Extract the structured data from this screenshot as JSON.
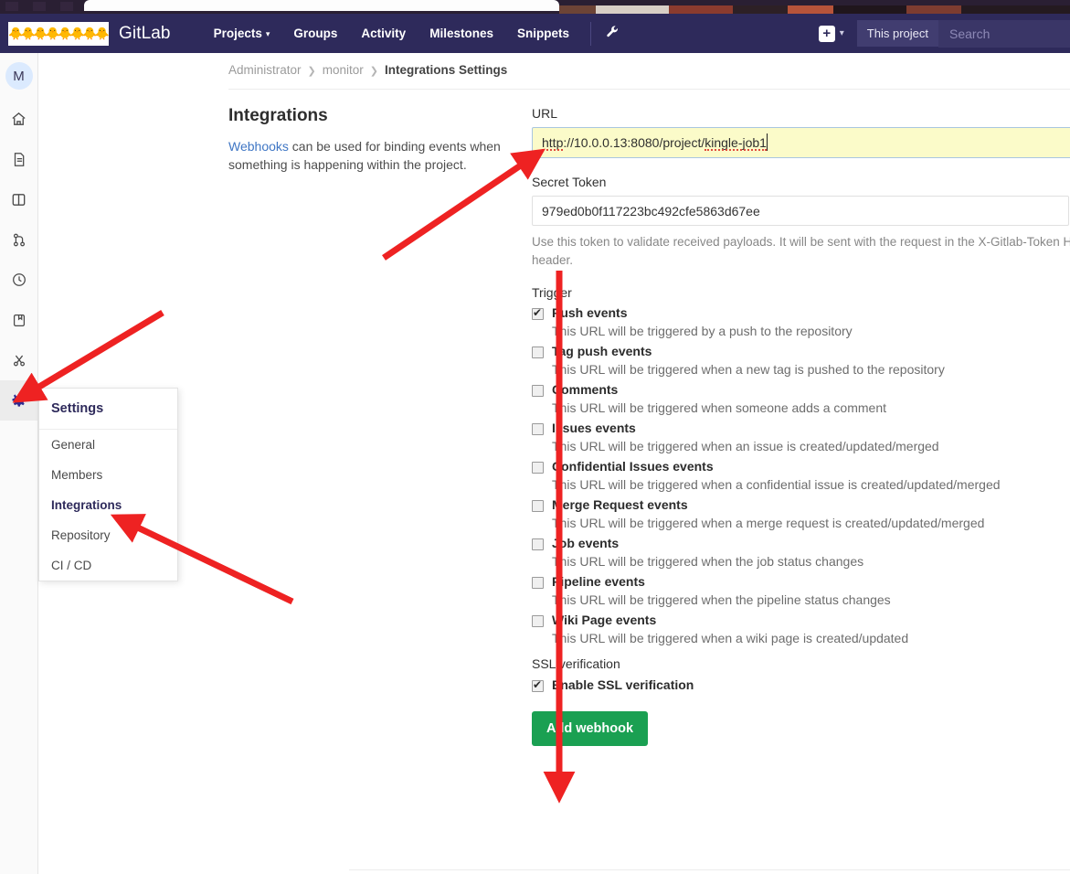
{
  "topnav": {
    "brand": "GitLab",
    "logo_emoji": "🐥",
    "logo_emoji_count": 8,
    "links": [
      {
        "label": "Projects",
        "has_caret": true
      },
      {
        "label": "Groups",
        "has_caret": false
      },
      {
        "label": "Activity",
        "has_caret": false
      },
      {
        "label": "Milestones",
        "has_caret": false
      },
      {
        "label": "Snippets",
        "has_caret": false
      }
    ],
    "wrench_icon": "wrench-icon",
    "plus_label": "+",
    "scope_label": "This project",
    "search_placeholder": "Search",
    "bg_color": "#2e2a5b"
  },
  "rail": {
    "avatar_initial": "M",
    "items": [
      {
        "name": "project-home",
        "icon": "home-icon"
      },
      {
        "name": "issues",
        "icon": "document-icon"
      },
      {
        "name": "repository",
        "icon": "book-icon"
      },
      {
        "name": "merge-requests",
        "icon": "merge-request-icon"
      },
      {
        "name": "ci-cd",
        "icon": "clock-icon"
      },
      {
        "name": "wiki",
        "icon": "wiki-book-icon"
      },
      {
        "name": "snippets",
        "icon": "scissors-icon"
      },
      {
        "name": "settings",
        "icon": "gear-icon"
      }
    ]
  },
  "settings_menu": {
    "header": "Settings",
    "items": [
      {
        "label": "General",
        "active": false
      },
      {
        "label": "Members",
        "active": false
      },
      {
        "label": "Integrations",
        "active": true
      },
      {
        "label": "Repository",
        "active": false
      },
      {
        "label": "CI / CD",
        "active": false
      }
    ]
  },
  "breadcrumb": {
    "items": [
      "Administrator",
      "monitor",
      "Integrations Settings"
    ],
    "separator": "❯"
  },
  "page": {
    "title": "Integrations",
    "description_link": "Webhooks",
    "description_rest": " can be used for binding events when something is happening within the project."
  },
  "form": {
    "url_label": "URL",
    "url_value": "http://10.0.0.13:8080/project/kingle-job1",
    "url_bg_color": "#fbfbc9",
    "token_label": "Secret Token",
    "token_value": "979ed0b0f117223bc492cfe5863d67ee",
    "token_help": "Use this token to validate received payloads. It will be sent with the request in the X-Gitlab-Token HTTP header.",
    "trigger_label": "Trigger",
    "triggers": [
      {
        "name": "Push events",
        "desc": "This URL will be triggered by a push to the repository",
        "checked": true
      },
      {
        "name": "Tag push events",
        "desc": "This URL will be triggered when a new tag is pushed to the repository",
        "checked": false
      },
      {
        "name": "Comments",
        "desc": "This URL will be triggered when someone adds a comment",
        "checked": false
      },
      {
        "name": "Issues events",
        "desc": "This URL will be triggered when an issue is created/updated/merged",
        "checked": false
      },
      {
        "name": "Confidential Issues events",
        "desc": "This URL will be triggered when a confidential issue is created/updated/merged",
        "checked": false
      },
      {
        "name": "Merge Request events",
        "desc": "This URL will be triggered when a merge request is created/updated/merged",
        "checked": false
      },
      {
        "name": "Job events",
        "desc": "This URL will be triggered when the job status changes",
        "checked": false
      },
      {
        "name": "Pipeline events",
        "desc": "This URL will be triggered when the pipeline status changes",
        "checked": false
      },
      {
        "name": "Wiki Page events",
        "desc": "This URL will be triggered when a wiki page is created/updated",
        "checked": false
      }
    ],
    "ssl_label": "SSL verification",
    "ssl_checkbox_label": "Enable SSL verification",
    "ssl_checked": true,
    "submit_label": "Add webhook",
    "submit_color": "#1aa052"
  },
  "annotations": {
    "color": "#ee2222",
    "arrows": [
      {
        "name": "arrow-to-url-field"
      },
      {
        "name": "arrow-to-settings-gear"
      },
      {
        "name": "arrow-to-integrations-menu-item"
      },
      {
        "name": "arrow-to-enable-ssl-verification"
      }
    ]
  }
}
